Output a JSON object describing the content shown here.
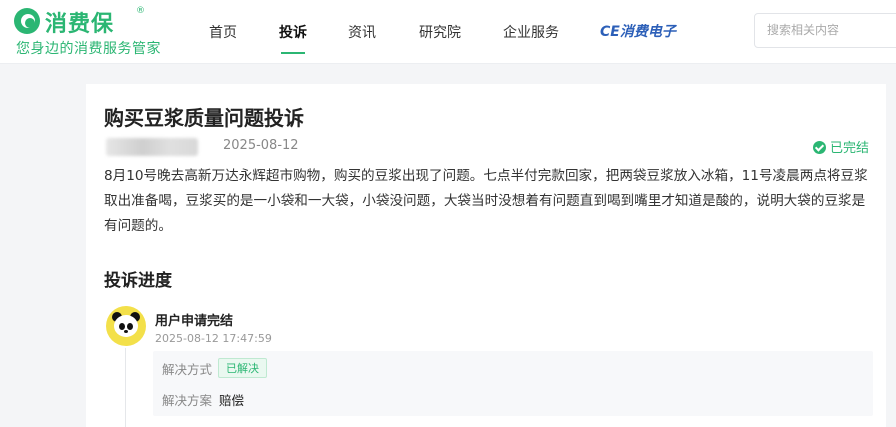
{
  "brand": {
    "name": "消费保",
    "registered": "®",
    "slogan": "您身边的消费服务管家",
    "accent_color": "#2bb673"
  },
  "nav": {
    "items": [
      {
        "label": "首页"
      },
      {
        "label": "投诉"
      },
      {
        "label": "资讯"
      },
      {
        "label": "研究院"
      },
      {
        "label": "企业服务"
      }
    ],
    "active": "投诉",
    "partner_logo": "CE消费电子"
  },
  "search": {
    "placeholder": "搜索相关内容"
  },
  "complaint": {
    "title": "购买豆浆质量问题投诉",
    "date": "2025-08-12",
    "status": "已完结",
    "status_icon": "check-circle-icon",
    "body": "8月10号晚去高新万达永辉超市购物，购买的豆浆出现了问题。七点半付完款回家，把两袋豆浆放入冰箱，11号凌晨两点将豆浆取出准备喝，豆浆买的是一小袋和一大袋，小袋没问题，大袋当时没想着有问题直到喝到嘴里才知道是酸的，说明大袋的豆浆是有问题的。"
  },
  "progress": {
    "section_title": "投诉进度",
    "events": [
      {
        "avatar_icon": "panda-avatar-icon",
        "title": "用户申请完结",
        "time": "2025-08-12 17:47:59",
        "resolution_label": "解决方式",
        "resolution_tag": "已解决",
        "plan_label": "解决方案",
        "plan_value": "赔偿"
      }
    ]
  }
}
